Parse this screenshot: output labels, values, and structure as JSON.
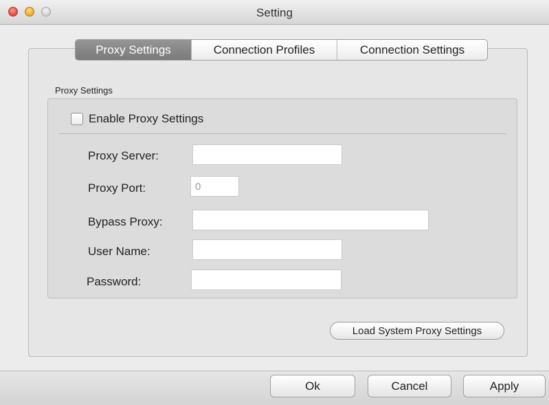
{
  "window": {
    "title": "Setting"
  },
  "tabs": [
    {
      "label": "Proxy Settings",
      "active": true
    },
    {
      "label": "Connection Profiles",
      "active": false
    },
    {
      "label": "Connection Settings",
      "active": false
    }
  ],
  "proxy_group": {
    "title": "Proxy Settings",
    "enable_checkbox": {
      "label": "Enable Proxy Settings",
      "checked": false
    },
    "fields": {
      "server": {
        "label": "Proxy Server:",
        "value": ""
      },
      "port": {
        "label": "Proxy Port:",
        "value": "",
        "placeholder": "0"
      },
      "bypass": {
        "label": "Bypass Proxy:",
        "value": ""
      },
      "username": {
        "label": "User Name:",
        "value": ""
      },
      "password": {
        "label": "Password:",
        "value": ""
      }
    }
  },
  "load_system_button": "Load System Proxy Settings",
  "bottom_buttons": {
    "ok": "Ok",
    "cancel": "Cancel",
    "apply": "Apply"
  }
}
